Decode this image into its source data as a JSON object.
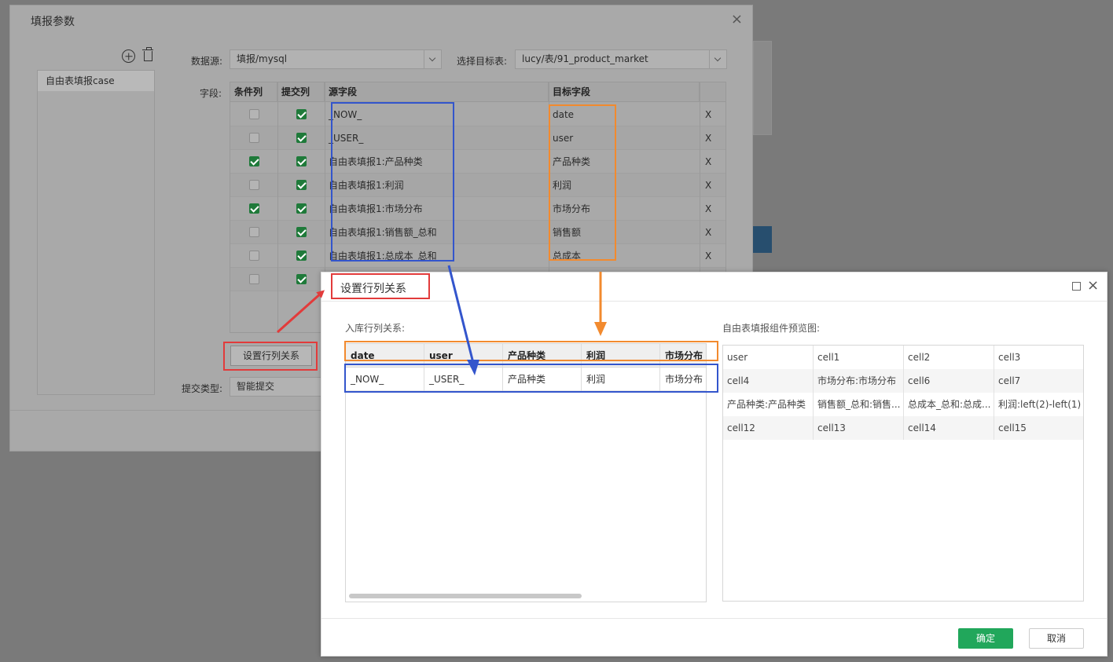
{
  "outer_dialog": {
    "title": "填报参数",
    "close_glyph": "×",
    "list_items": [
      "自由表填报case"
    ],
    "datasource_label": "数据源:",
    "datasource_value": "填报/mysql",
    "target_table_label": "选择目标表:",
    "target_table_value": "lucy/表/91_product_market",
    "fields_label": "字段:",
    "submit_type_label": "提交类型:",
    "submit_type_value": "智能提交",
    "set_relation_button": "设置行列关系",
    "field_table": {
      "headers": [
        "条件列",
        "提交列",
        "源字段",
        "目标字段",
        ""
      ],
      "rows": [
        {
          "condition": false,
          "submit": true,
          "source": "_NOW_",
          "target": "date",
          "delete": "X"
        },
        {
          "condition": false,
          "submit": true,
          "source": "_USER_",
          "target": "user",
          "delete": "X"
        },
        {
          "condition": true,
          "submit": true,
          "source": "自由表填报1:产品种类",
          "target": "产品种类",
          "delete": "X"
        },
        {
          "condition": false,
          "submit": true,
          "source": "自由表填报1:利润",
          "target": "利润",
          "delete": "X"
        },
        {
          "condition": true,
          "submit": true,
          "source": "自由表填报1:市场分布",
          "target": "市场分布",
          "delete": "X"
        },
        {
          "condition": false,
          "submit": true,
          "source": "自由表填报1:销售额_总和",
          "target": "销售额",
          "delete": "X"
        },
        {
          "condition": false,
          "submit": true,
          "source": "自由表填报1:总成本_总和",
          "target": "总成本",
          "delete": "X"
        },
        {
          "condition": false,
          "submit": true,
          "source": "",
          "target": "",
          "delete": ""
        }
      ]
    }
  },
  "inner_dialog": {
    "title": "设置行列关系",
    "close_glyph": "×",
    "left_label": "入库行列关系:",
    "right_label": "自由表填报组件预览图:",
    "grid_headers": [
      "date",
      "user",
      "产品种类",
      "利润",
      "市场分布"
    ],
    "grid_row": [
      "_NOW_",
      "_USER_",
      "产品种类",
      "利润",
      "市场分布"
    ],
    "preview_rows": [
      [
        "user",
        "cell1",
        "cell2",
        "cell3"
      ],
      [
        "cell4",
        "市场分布:市场分布",
        "cell6",
        "cell7"
      ],
      [
        "产品种类:产品种类",
        "销售额_总和:销售...",
        "总成本_总和:总成...",
        "利润:left(2)-left(1)"
      ],
      [
        "cell12",
        "cell13",
        "cell14",
        "cell15"
      ]
    ],
    "ok_button": "确定",
    "cancel_button": "取消"
  },
  "colors": {
    "annotation_blue": "#3355cc",
    "annotation_orange": "#f28a2e",
    "annotation_red": "#e23b3b",
    "ok_green": "#21a75b",
    "checkbox_green": "#1f7a3a"
  }
}
